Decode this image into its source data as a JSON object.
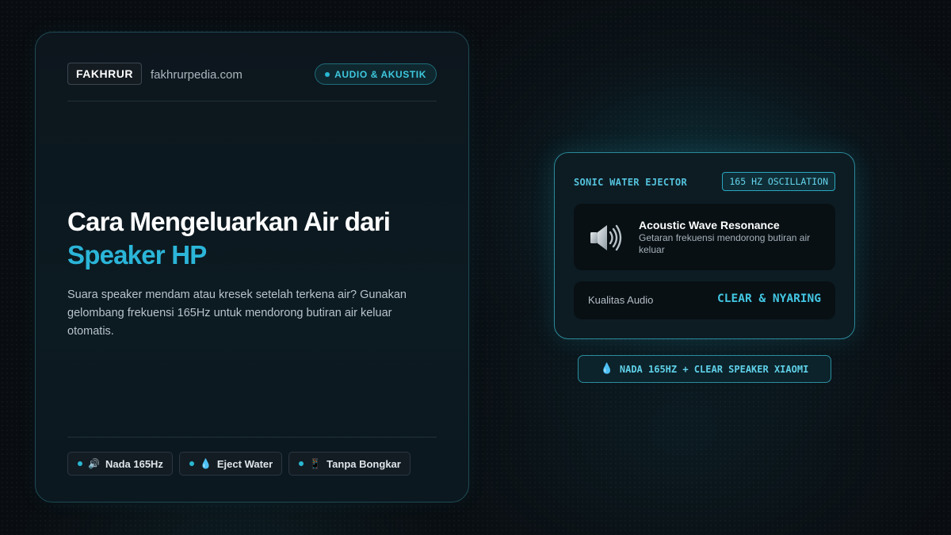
{
  "header": {
    "brand": "FAKHRUR",
    "site": "fakhrurpedia.com",
    "category": "AUDIO & AKUSTIK"
  },
  "article": {
    "title_line1": "Cara Mengeluarkan Air dari",
    "title_line2": "Speaker HP",
    "description": "Suara speaker mendam atau kresek setelah terkena air? Gunakan gelombang frekuensi 165Hz untuk mendorong butiran air keluar otomatis."
  },
  "tags": [
    {
      "emoji": "🔊",
      "label": "Nada 165Hz"
    },
    {
      "emoji": "💧",
      "label": "Eject Water"
    },
    {
      "emoji": "📱",
      "label": "Tanpa Bongkar"
    }
  ],
  "ejector": {
    "title": "SONIC WATER EJECTOR",
    "badge": "165 HZ OSCILLATION",
    "resonance_title": "Acoustic Wave Resonance",
    "resonance_subtitle": "Getaran frekuensi mendorong butiran air keluar",
    "speaker_icon": "speaker-icon",
    "quality_label": "Kualitas Audio",
    "quality_value": "CLEAR & NYARING"
  },
  "footer": {
    "emoji": "💧",
    "label": "NADA 165HZ + CLEAR SPEAKER XIAOMI"
  },
  "colors": {
    "accent": "#2bb5d8",
    "background": "#090d11",
    "card_border": "#1f4a54"
  }
}
